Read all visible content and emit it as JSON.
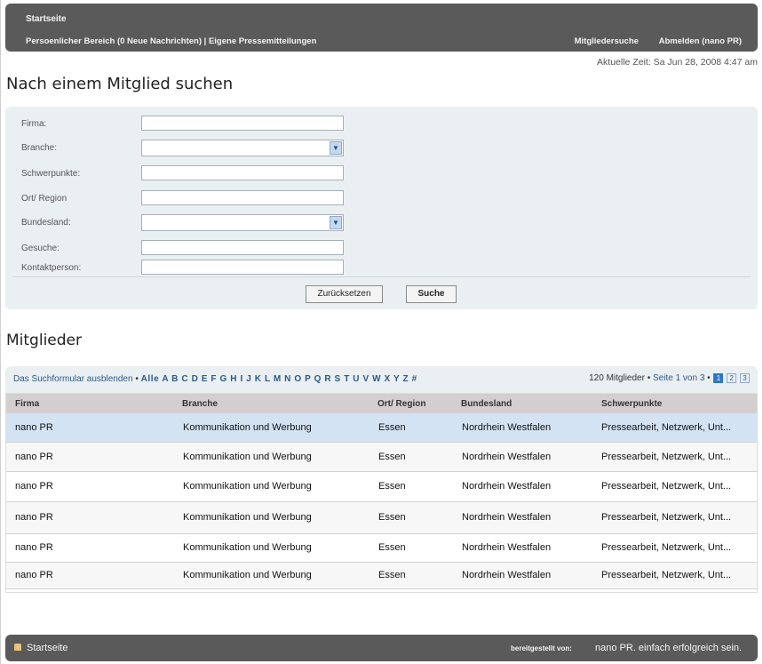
{
  "header": {
    "home": "Startseite",
    "personal": "Persoenlicher Bereich",
    "messages": "(0 Neue Nachrichten)",
    "separator": "|",
    "press_releases": "Eigene Pressemitteilungen",
    "member_search": "Mitgliedersuche",
    "logout": "Abmelden (nano PR)"
  },
  "current_time": "Aktuelle Zeit: Sa Jun 28, 2008 4:47 am",
  "search": {
    "title": "Nach einem Mitglied suchen",
    "fields": {
      "firma": "Firma:",
      "branche": "Branche:",
      "schwerpunkte": "Schwerpunkte:",
      "ort": "Ort/ Region",
      "bundesland": "Bundesland:",
      "gesuche": "Gesuche:",
      "kontaktperson": "Kontaktperson:"
    },
    "values": {
      "firma": "",
      "branche": "",
      "schwerpunkte": "",
      "ort": "",
      "bundesland": "",
      "gesuche": "",
      "kontaktperson": ""
    },
    "reset_label": "Zurücksetzen",
    "submit_label": "Suche"
  },
  "members": {
    "title": "Mitglieder",
    "hide_form": "Das Suchformular ausblenden",
    "alphabet": "Alle A B C D E F G H I J K L M N O P Q R S T U V W X Y Z #",
    "count": "120 Mitglieder",
    "page_info": "Seite 1 von 3",
    "pages": [
      "1",
      "2",
      "3"
    ],
    "columns": [
      "Firma",
      "Branche",
      "Ort/ Region",
      "Bundesland",
      "Schwerpunkte"
    ],
    "rows": [
      [
        "nano PR",
        "Kommunikation und Werbung",
        "Essen",
        "Nordrhein Westfalen",
        "Pressearbeit, Netzwerk, Unt..."
      ],
      [
        "nano PR",
        "Kommunikation und Werbung",
        "Essen",
        "Nordrhein Westfalen",
        "Pressearbeit, Netzwerk, Unt..."
      ],
      [
        "nano PR",
        "Kommunikation und Werbung",
        "Essen",
        "Nordrhein Westfalen",
        "Pressearbeit, Netzwerk, Unt..."
      ],
      [
        "nano PR",
        "Kommunikation und Werbung",
        "Essen",
        "Nordrhein Westfalen",
        "Pressearbeit, Netzwerk, Unt..."
      ],
      [
        "nano PR",
        "Kommunikation und Werbung",
        "Essen",
        "Nordrhein Westfalen",
        "Pressearbeit, Netzwerk, Unt..."
      ],
      [
        "nano PR",
        "Kommunikation und Werbung",
        "Essen",
        "Nordrhein Westfalen",
        "Pressearbeit, Netzwerk, Unt..."
      ]
    ]
  },
  "footer": {
    "home": "Startseite",
    "provided_by": "bereitgestellt von:",
    "slogan": "nano PR. einfach erfolgreich sein."
  },
  "colors": {
    "bar": "#5a5a5a",
    "panel": "#eaeff2",
    "link": "#2d5a8a",
    "selected_row": "#d4e3f4"
  },
  "icons": {
    "dropdown": "chevron-down-icon",
    "footer_home": "lock-icon"
  }
}
